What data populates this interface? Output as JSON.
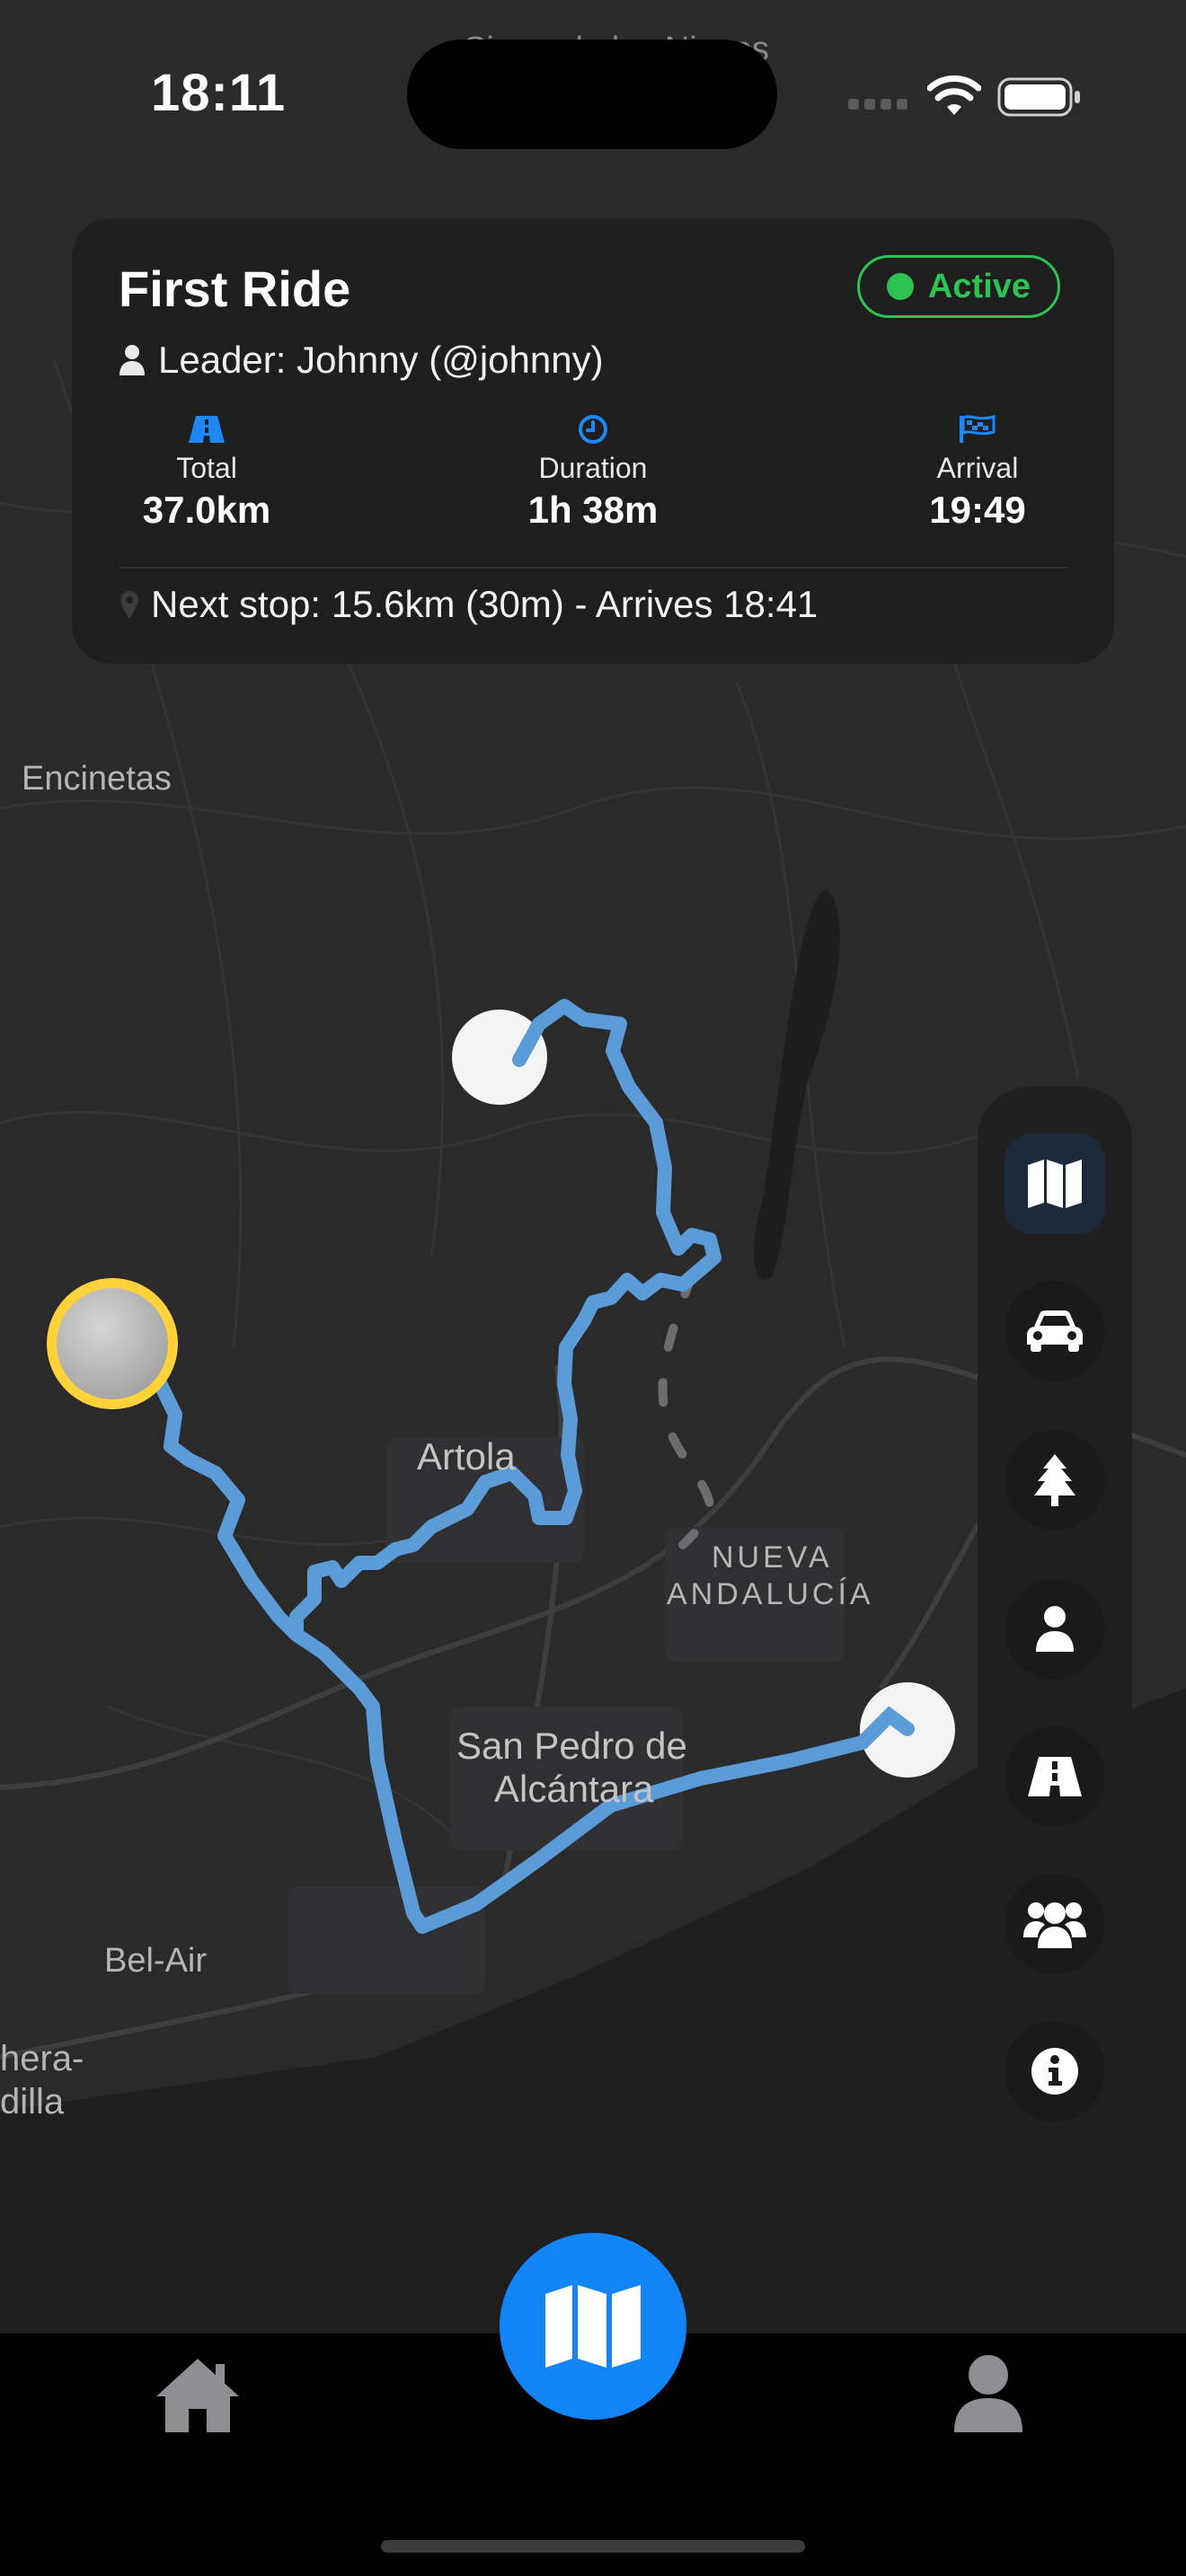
{
  "status_bar": {
    "time": "18:11"
  },
  "map_labels": {
    "top_partial": "Sierra de las Nieves",
    "encinetas": "Encinetas",
    "artola": "Artola",
    "nueva_1": "NUEVA",
    "nueva_2": "ANDALUCÍA",
    "san_pedro_1": "San Pedro de",
    "san_pedro_2": "Alcántara",
    "bel_air": "Bel-Air",
    "estepona_1": "hera-",
    "estepona_2": "dilla"
  },
  "ride": {
    "title": "First Ride",
    "status": "Active",
    "status_color": "#2ec253",
    "leader": "Leader: Johnny (@johnny)",
    "stats": [
      {
        "icon": "road-icon",
        "label": "Total",
        "value": "37.0km"
      },
      {
        "icon": "clock-icon",
        "label": "Duration",
        "value": "1h 38m"
      },
      {
        "icon": "flag-icon",
        "label": "Arrival",
        "value": "19:49"
      }
    ],
    "next_stop": "Next stop: 15.6km (30m) - Arrives 18:41"
  },
  "side_panel": {
    "items": [
      {
        "icon": "map-icon",
        "selected": true
      },
      {
        "icon": "car-icon",
        "selected": false
      },
      {
        "icon": "tree-icon",
        "selected": false
      },
      {
        "icon": "person-icon",
        "selected": false
      },
      {
        "icon": "road-icon",
        "selected": false
      },
      {
        "icon": "group-icon",
        "selected": false
      },
      {
        "icon": "info-icon",
        "selected": false
      }
    ]
  },
  "tabbar": {
    "items": [
      "home-icon",
      "map-icon",
      "profile-icon"
    ],
    "accent": "#1284f6"
  },
  "route_color": "#5a9bd8"
}
